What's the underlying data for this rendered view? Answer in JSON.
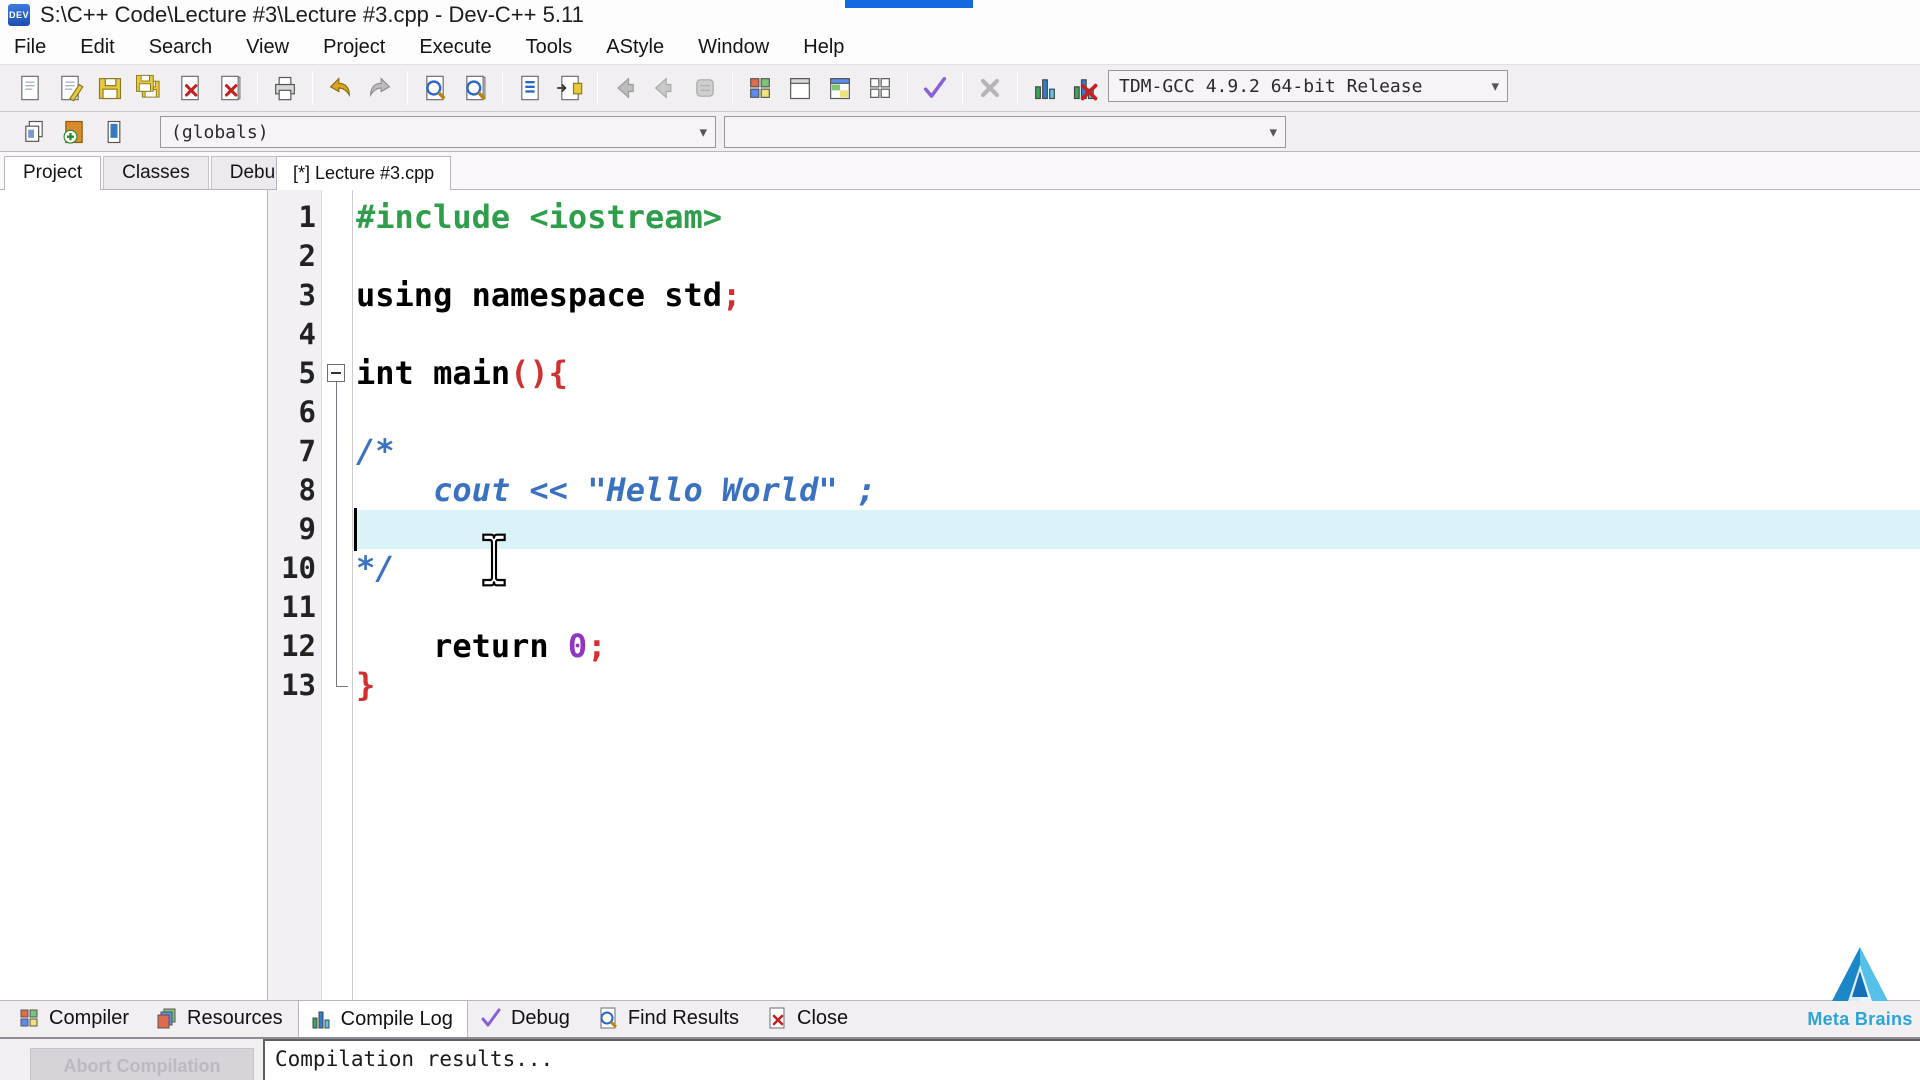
{
  "colors": {
    "green": "#2E9E4B",
    "comment": "#3B72C0",
    "red": "#D23030",
    "purple": "#9036C0",
    "black": "#000000",
    "active_line_bg": "#D9F3F8",
    "brand": "#2AA5D6",
    "accent_strip": "#1569E0"
  },
  "title_bar": {
    "app_icon_text": "DEV",
    "title": "S:\\C++ Code\\Lecture #3\\Lecture #3.cpp - Dev-C++ 5.11"
  },
  "menu": {
    "items": [
      "File",
      "Edit",
      "Search",
      "View",
      "Project",
      "Execute",
      "Tools",
      "AStyle",
      "Window",
      "Help"
    ]
  },
  "toolbar": {
    "row1": [
      "new-file",
      "open-file",
      "save",
      "save-all",
      "close-file",
      "close-all",
      "sep",
      "print",
      "sep",
      "undo",
      "redo",
      "sep",
      "find",
      "replace",
      "sep",
      "goto-line",
      "toggle-bookmark",
      "sep",
      "back",
      "forward",
      "nav-stop",
      "sep",
      "compile",
      "run",
      "compile-run",
      "rebuild",
      "sep",
      "syntax-check",
      "sep",
      "abort",
      "sep",
      "profile",
      "delete-profiling"
    ],
    "row2": [
      "insert-snippet",
      "add-bookmark",
      "goto-bookmark"
    ],
    "compiler_profile": "TDM-GCC 4.9.2 64-bit Release"
  },
  "navbar": {
    "globals_value": "(globals)",
    "members_value": ""
  },
  "left_panel": {
    "tabs": [
      "Project",
      "Classes",
      "Debug"
    ],
    "active_tab": "Project"
  },
  "editor": {
    "tab_label": "[*] Lecture #3.cpp",
    "active_line": 9,
    "lines": [
      {
        "n": 1,
        "tokens": [
          {
            "t": "#include <iostream>",
            "c": "green"
          }
        ]
      },
      {
        "n": 2,
        "tokens": []
      },
      {
        "n": 3,
        "tokens": [
          {
            "t": "using namespace std",
            "c": "black"
          },
          {
            "t": ";",
            "c": "red"
          }
        ]
      },
      {
        "n": 4,
        "tokens": []
      },
      {
        "n": 5,
        "fold": "start",
        "tokens": [
          {
            "t": "int main",
            "c": "black"
          },
          {
            "t": "(){",
            "c": "red"
          }
        ]
      },
      {
        "n": 6,
        "tokens": []
      },
      {
        "n": 7,
        "tokens": [
          {
            "t": "/*",
            "c": "comment"
          }
        ]
      },
      {
        "n": 8,
        "tokens": [
          {
            "t": "    cout << \"Hello World\" ;",
            "c": "comment"
          }
        ]
      },
      {
        "n": 9,
        "caret": true,
        "tokens": []
      },
      {
        "n": 10,
        "tokens": [
          {
            "t": "*/",
            "c": "comment"
          }
        ]
      },
      {
        "n": 11,
        "tokens": []
      },
      {
        "n": 12,
        "tokens": [
          {
            "t": "    return ",
            "c": "black"
          },
          {
            "t": "0",
            "c": "purple"
          },
          {
            "t": ";",
            "c": "red"
          }
        ]
      },
      {
        "n": 13,
        "fold": "end",
        "tokens": [
          {
            "t": "}",
            "c": "red"
          }
        ]
      }
    ]
  },
  "bottom_tabs": {
    "items": [
      {
        "label": "Compiler",
        "icon": "compile"
      },
      {
        "label": "Resources",
        "icon": "pages"
      },
      {
        "label": "Compile Log",
        "icon": "profile",
        "active": true
      },
      {
        "label": "Debug",
        "icon": "syntax-check"
      },
      {
        "label": "Find Results",
        "icon": "find"
      },
      {
        "label": "Close",
        "icon": "close-file"
      }
    ]
  },
  "compile_panel": {
    "abort_label": "Abort Compilation",
    "log_text": "Compilation results..."
  },
  "watermark": {
    "text": "Meta Brains"
  }
}
